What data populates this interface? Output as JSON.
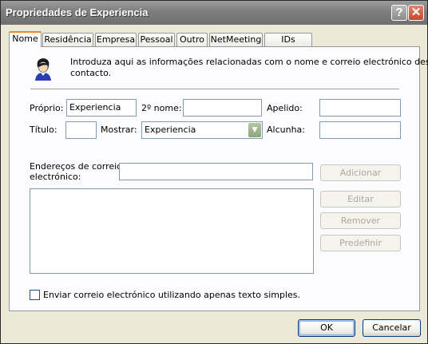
{
  "window": {
    "title": "Propriedades de Experiencia",
    "help_label": "?",
    "close_label": "✕"
  },
  "tabs": [
    {
      "label": "Nome"
    },
    {
      "label": "Residência"
    },
    {
      "label": "Empresa"
    },
    {
      "label": "Pessoal"
    },
    {
      "label": "Outro"
    },
    {
      "label": "NetMeeting"
    },
    {
      "label": "IDs digitais"
    }
  ],
  "intro": {
    "icon": "person-icon",
    "text_line1": "Introduza aqui as informações relacionadas com o nome e correio electrónico deste",
    "text_line2": "contacto."
  },
  "form": {
    "proprio_label": "Próprio:",
    "proprio_value": "Experiencia",
    "segundo_nome_label": "2º nome:",
    "segundo_nome_value": "",
    "apelido_label": "Apelido:",
    "apelido_value": "",
    "titulo_label": "Título:",
    "titulo_value": "",
    "mostrar_label": "Mostrar:",
    "mostrar_value": "Experiencia",
    "alcunha_label": "Alcunha:",
    "alcunha_value": ""
  },
  "email": {
    "label_line1": "Endereços de correio",
    "label_line2": "electrónico:",
    "input_value": "",
    "add_label": "Adicionar",
    "edit_label": "Editar",
    "remove_label": "Remover",
    "default_label": "Predefinir"
  },
  "plain_text": {
    "label": "Enviar correio electrónico utilizando apenas texto simples.",
    "checked": false
  },
  "footer": {
    "ok_label": "OK",
    "cancel_label": "Cancelar"
  }
}
